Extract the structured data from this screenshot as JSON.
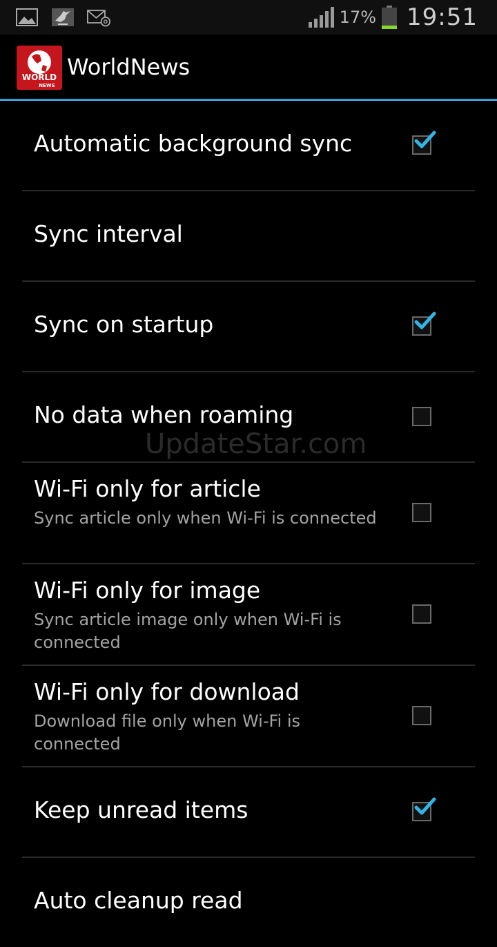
{
  "status_bar": {
    "icons": [
      "gallery-icon",
      "bird-icon",
      "email-icon"
    ],
    "battery_percent": "17%",
    "battery_level": 0.17,
    "time": "19:51",
    "signal_icon": "signal-bars-icon"
  },
  "action_bar": {
    "app_icon": "worldnews-logo",
    "logo_text_top": "WORLD",
    "logo_text_bottom": "NEWS",
    "title": "WorldNews"
  },
  "watermark": "UpdateStar.com",
  "settings": [
    {
      "title": "Automatic background sync",
      "summary": "",
      "checked": true,
      "has_checkbox": true
    },
    {
      "title": "Sync interval",
      "summary": "",
      "checked": false,
      "has_checkbox": false
    },
    {
      "title": "Sync on startup",
      "summary": "",
      "checked": true,
      "has_checkbox": true
    },
    {
      "title": "No data when roaming",
      "summary": "",
      "checked": false,
      "has_checkbox": true
    },
    {
      "title": "Wi-Fi only for article",
      "summary": "Sync article only when Wi-Fi is connected",
      "checked": false,
      "has_checkbox": true
    },
    {
      "title": "Wi-Fi only for image",
      "summary": "Sync article image only when Wi-Fi is connected",
      "checked": false,
      "has_checkbox": true
    },
    {
      "title": "Wi-Fi only for download",
      "summary": "Download file only when Wi-Fi is connected",
      "checked": false,
      "has_checkbox": true
    },
    {
      "title": "Keep unread items",
      "summary": "",
      "checked": true,
      "has_checkbox": true
    },
    {
      "title": "Auto cleanup read",
      "summary": "",
      "checked": false,
      "has_checkbox": false
    }
  ],
  "colors": {
    "accent": "#3aa0d8",
    "check": "#33b5e5",
    "logo_red": "#c4161c"
  }
}
